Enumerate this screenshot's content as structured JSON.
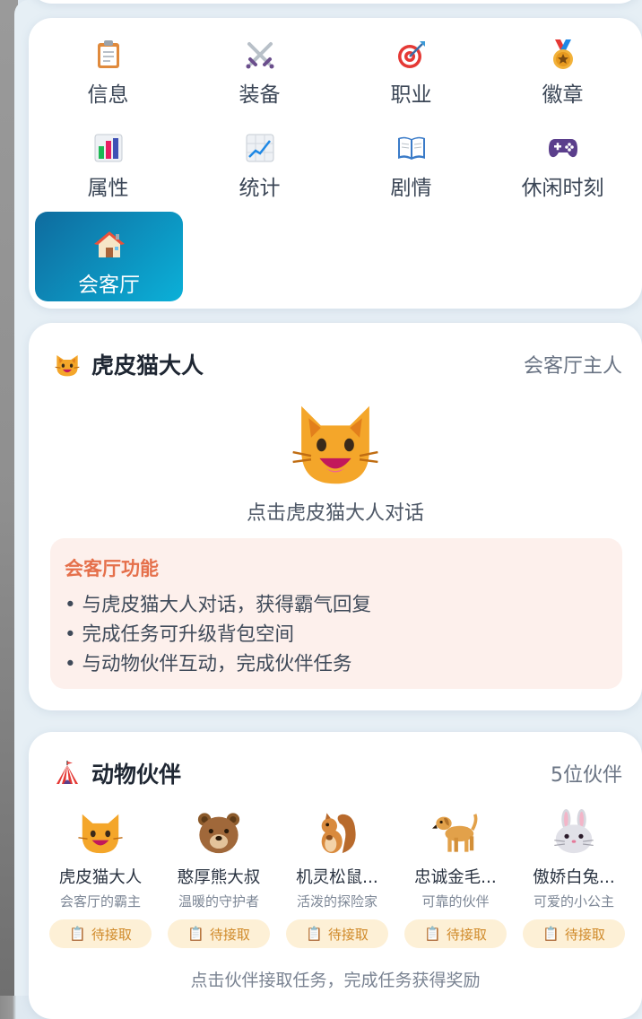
{
  "nav": {
    "items": [
      {
        "label": "信息",
        "icon": "clipboard-icon"
      },
      {
        "label": "装备",
        "icon": "crossed-swords-icon"
      },
      {
        "label": "职业",
        "icon": "target-icon"
      },
      {
        "label": "徽章",
        "icon": "medal-icon"
      },
      {
        "label": "属性",
        "icon": "bar-chart-icon"
      },
      {
        "label": "统计",
        "icon": "trend-chart-icon"
      },
      {
        "label": "剧情",
        "icon": "open-book-icon"
      },
      {
        "label": "休闲时刻",
        "icon": "game-controller-icon"
      },
      {
        "label": "会客厅",
        "icon": "house-icon",
        "active": true
      }
    ]
  },
  "lounge": {
    "title": "虎皮猫大人",
    "role": "会客厅主人",
    "hint": "点击虎皮猫大人对话",
    "functions": {
      "title": "会客厅功能",
      "lines": [
        "• 与虎皮猫大人对话，获得霸气回复",
        "• 完成任务可升级背包空间",
        "• 与动物伙伴互动，完成伙伴任务"
      ]
    }
  },
  "partners": {
    "title": "动物伙伴",
    "count": "5位伙伴",
    "list": [
      {
        "name": "虎皮猫大人",
        "desc": "会客厅的霸主",
        "status": "待接取",
        "icon": "cat-icon"
      },
      {
        "name": "憨厚熊大叔",
        "desc": "温暖的守护者",
        "status": "待接取",
        "icon": "bear-icon"
      },
      {
        "name": "机灵松鼠...",
        "desc": "活泼的探险家",
        "status": "待接取",
        "icon": "squirrel-icon"
      },
      {
        "name": "忠诚金毛...",
        "desc": "可靠的伙伴",
        "status": "待接取",
        "icon": "dog-icon"
      },
      {
        "name": "傲娇白兔...",
        "desc": "可爱的小公主",
        "status": "待接取",
        "icon": "rabbit-icon"
      }
    ],
    "footer": "点击伙伴接取任务，完成任务获得奖励"
  },
  "colors": {
    "active_gradient_start": "#0f6b9e",
    "active_gradient_end": "#0bb0d8",
    "function_title": "#e5704b",
    "badge_bg": "#fdf0d6",
    "badge_text": "#d08a2a"
  }
}
